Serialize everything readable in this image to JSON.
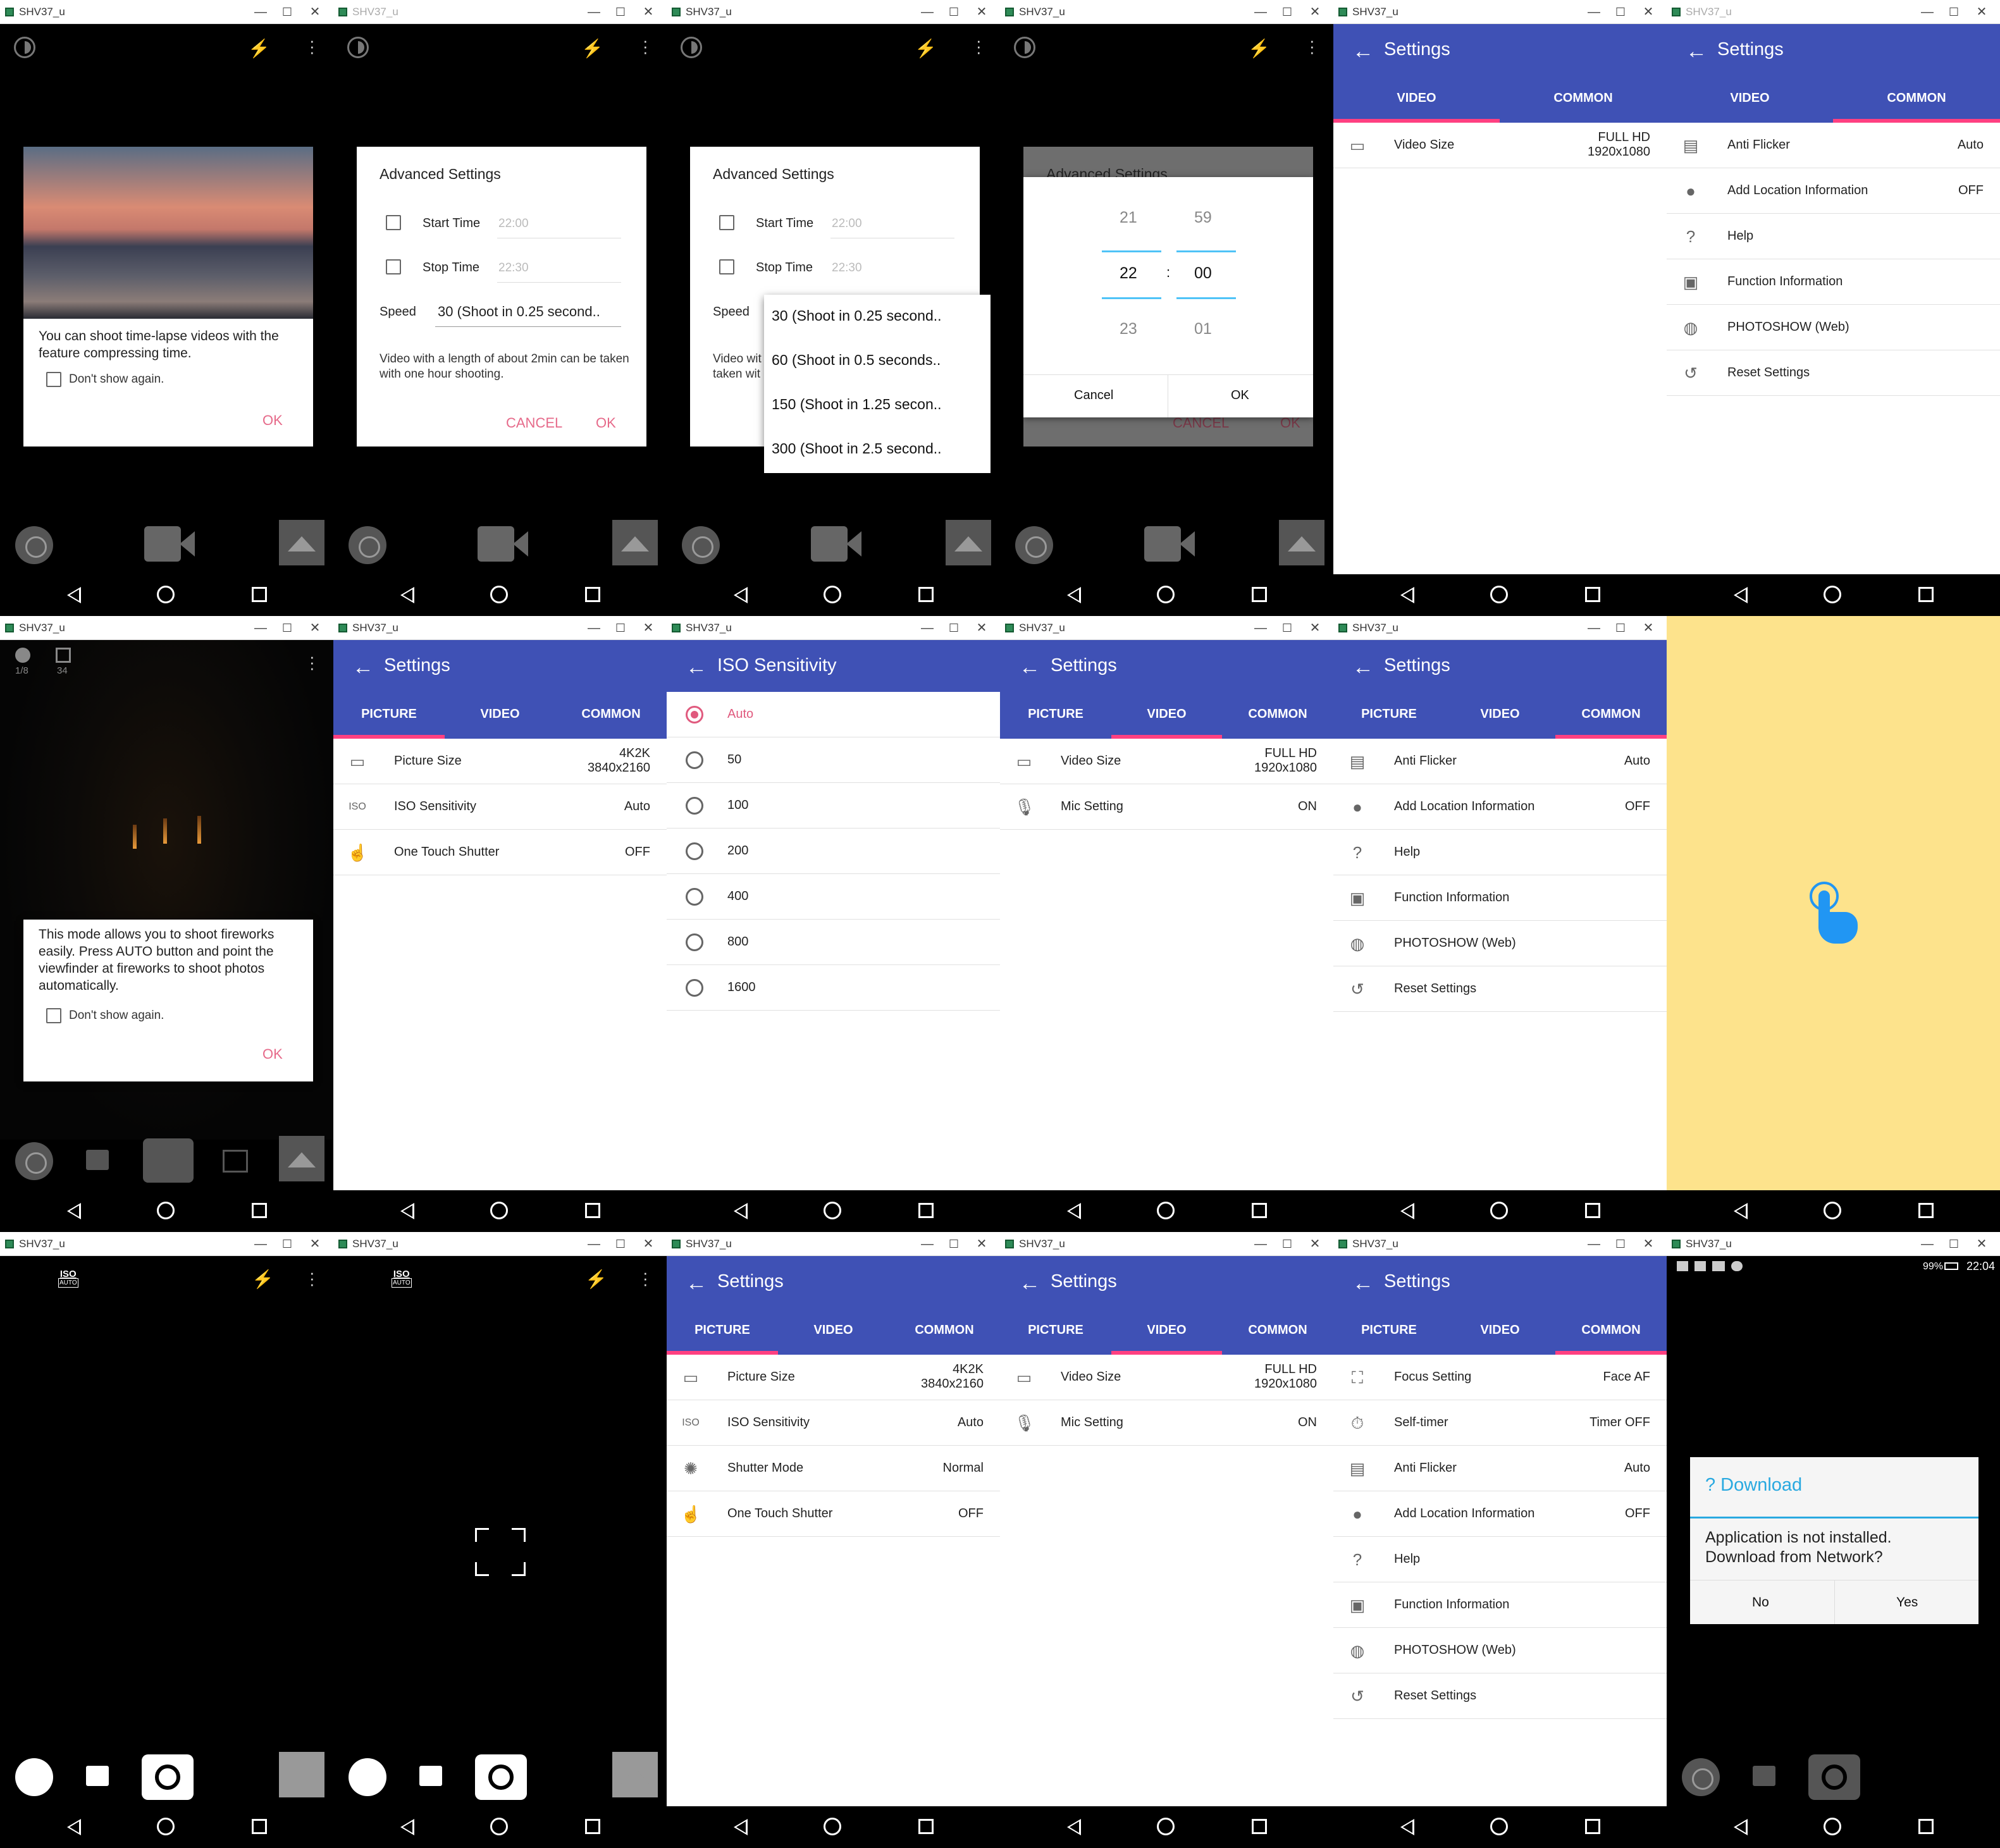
{
  "window": {
    "title": "SHV37_u",
    "min": "—",
    "max": "☐",
    "close": "✕"
  },
  "timelapse": {
    "message": "You can shoot time-lapse videos with the feature compressing time.",
    "dont_show": "Don't show again.",
    "ok": "OK"
  },
  "advanced": {
    "title": "Advanced Settings",
    "start_label": "Start Time",
    "start_value": "22:00",
    "stop_label": "Stop Time",
    "stop_value": "22:30",
    "speed_label": "Speed",
    "speed_value": "30 (Shoot in 0.25 second..",
    "note": "Video with a length of about 2min can be taken with one hour shooting.",
    "note_cut": "Video wit",
    "note_cut2": "taken wit",
    "cancel": "CANCEL",
    "ok": "OK",
    "speed_options": [
      "30 (Shoot in 0.25 second..",
      "60 (Shoot in 0.5 seconds..",
      "150 (Shoot in 1.25 secon..",
      "300 (Shoot in 2.5 second.."
    ]
  },
  "timepicker": {
    "bg_title": "Advanced Settings",
    "hours": [
      "21",
      "22",
      "23"
    ],
    "minutes": [
      "59",
      "00",
      "01"
    ],
    "sep": ":",
    "cancel": "Cancel",
    "ok": "OK",
    "bg_cancel": "CANCEL",
    "bg_ok": "OK"
  },
  "settings": {
    "title": "Settings",
    "back": "←",
    "tab_picture": "PICTURE",
    "tab_video": "VIDEO",
    "tab_common": "COMMON",
    "video_size": "Video Size",
    "video_size_v1": "FULL HD",
    "video_size_v2": "1920x1080",
    "mic": "Mic Setting",
    "mic_v": "ON",
    "picture_size": "Picture Size",
    "picture_size_v1": "4K2K",
    "picture_size_v2": "3840x2160",
    "iso": "ISO Sensitivity",
    "iso_v": "Auto",
    "one_touch": "One Touch Shutter",
    "one_touch_v": "OFF",
    "shutter_mode": "Shutter Mode",
    "shutter_mode_v": "Normal",
    "anti_flicker": "Anti Flicker",
    "anti_flicker_v": "Auto",
    "location": "Add Location Information",
    "location_v": "OFF",
    "help": "Help",
    "function_info": "Function Information",
    "photoshow": "PHOTOSHOW (Web)",
    "reset": "Reset Settings",
    "focus": "Focus Setting",
    "focus_v": "Face AF",
    "timer": "Self-timer",
    "timer_v": "Timer OFF"
  },
  "iso_screen": {
    "title": "ISO Sensitivity",
    "options": [
      "Auto",
      "50",
      "100",
      "200",
      "400",
      "800",
      "1600"
    ]
  },
  "fireworks": {
    "message": "This mode allows you to shoot fireworks easily. Press AUTO button and point the viewfinder at fireworks to shoot photos automatically.",
    "dont_show": "Don't show again.",
    "ok": "OK",
    "ind1": "1/8",
    "ind2": "34"
  },
  "iso_badge": {
    "top": "ISO",
    "bottom": "AUTO"
  },
  "download": {
    "title": "? Download",
    "message": "Application is not installed. Download from Network?",
    "no": "No",
    "yes": "Yes",
    "battery": "99%",
    "clock": "22:04"
  },
  "colors": {
    "appbar": "#3f51b5",
    "accent": "#ff4081",
    "dialog_button": "#e66a8a",
    "touch_panel": "#fde38c"
  }
}
